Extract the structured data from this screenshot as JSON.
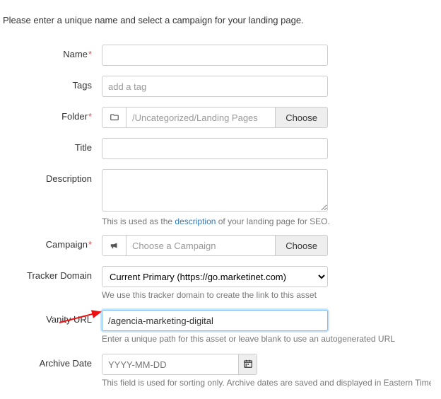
{
  "intro": "Please enter a unique name and select a campaign for your landing page.",
  "labels": {
    "name": "Name",
    "tags": "Tags",
    "folder": "Folder",
    "title": "Title",
    "description": "Description",
    "campaign": "Campaign",
    "tracker_domain": "Tracker Domain",
    "vanity_url": "Vanity URL",
    "archive_date": "Archive Date"
  },
  "fields": {
    "name_value": "",
    "tags_placeholder": "add a tag",
    "tags_value": "",
    "folder_value": "/Uncategorized/Landing Pages",
    "title_value": "",
    "description_value": "",
    "campaign_value": "Choose a Campaign",
    "tracker_domain_value": "Current Primary (https://go.marketinet.com)",
    "vanity_url_value": "/agencia-marketing-digital",
    "archive_date_placeholder": "YYYY-MM-DD",
    "archive_date_value": ""
  },
  "buttons": {
    "choose": "Choose"
  },
  "help": {
    "description_pre": "This is used as the ",
    "description_link": "description",
    "description_post": " of your landing page for SEO.",
    "tracker_domain": "We use this tracker domain to create the link to this asset",
    "vanity_url": "Enter a unique path for this asset or leave blank to use an autogenerated URL",
    "archive_date": "This field is used for sorting only. Archive dates are saved and displayed in Eastern Time (Americas"
  }
}
